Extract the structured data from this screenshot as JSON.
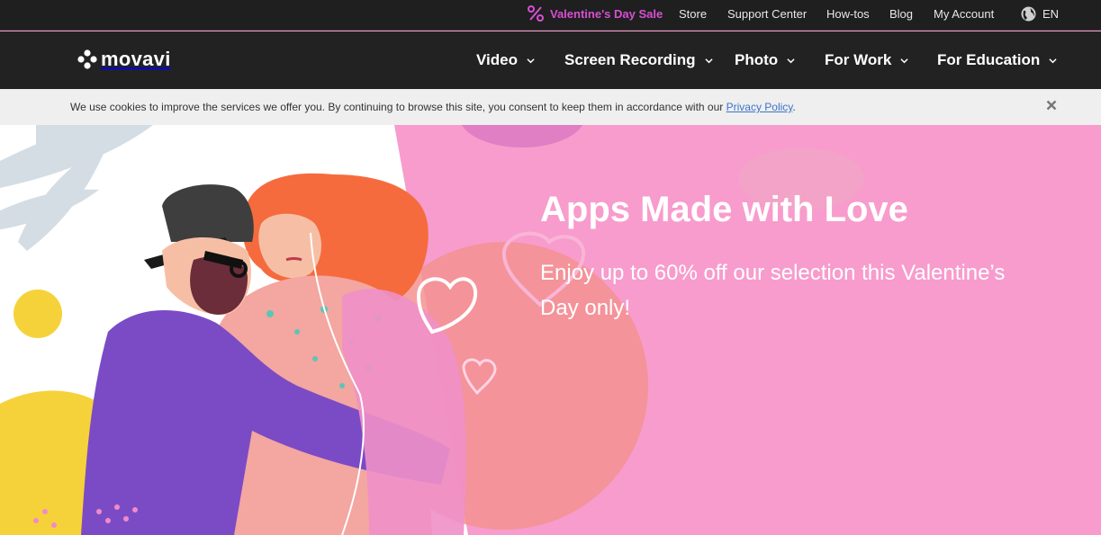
{
  "topbar": {
    "sale_label": "Valentine's Day Sale",
    "links": [
      "Store",
      "Support Center",
      "How-tos",
      "Blog",
      "My Account"
    ],
    "language": "EN"
  },
  "nav": {
    "brand": "movavi",
    "items": [
      "Video",
      "Screen Recording",
      "Photo",
      "For Work",
      "For Education"
    ]
  },
  "cookie": {
    "message": "We use cookies to improve the services we offer you. By continuing to browse this site, you consent to keep them in accordance with our ",
    "link_text": "Privacy Policy",
    "period": "."
  },
  "hero": {
    "title": "Apps Made with Love",
    "subtitle": "Enjoy up to 60% off our selection this Valentine’s Day only!"
  },
  "icons": {
    "sale": "percent-icon",
    "language": "globe-icon",
    "close": "close-icon",
    "dropdown": "chevron-down-icon"
  },
  "colors": {
    "topbar_bg": "#1f1f1f",
    "nav_bg": "#222222",
    "sale_accent": "#d84fd4",
    "hero_bg": "#f79ccd",
    "link": "#3b73c9"
  }
}
